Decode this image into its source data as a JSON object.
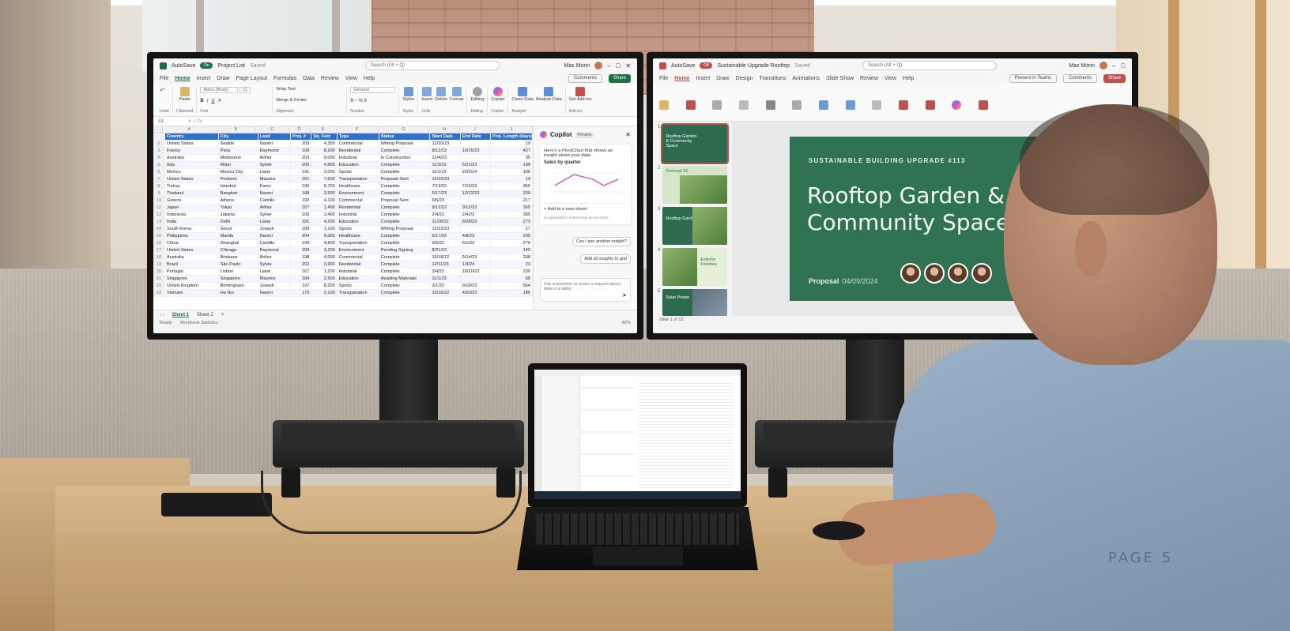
{
  "page_label": "PAGE 5",
  "excel": {
    "autosave": "AutoSave",
    "toggle": "On",
    "file_name": "Project List",
    "saved": "Saved",
    "search": "Search (Alt + Q)",
    "user": "Max Morin",
    "tabs": [
      "File",
      "Home",
      "Insert",
      "Draw",
      "Page Layout",
      "Formulas",
      "Data",
      "Review",
      "View",
      "Help"
    ],
    "comments": "Comments",
    "share": "Share",
    "ribbon": {
      "font": "Aptos (Body)",
      "size": "11",
      "wrap": "Wrap Text",
      "merge": "Merge & Center",
      "number_format": "General",
      "styles": "Styles",
      "insert": "Insert",
      "delete": "Delete",
      "format": "Format",
      "editing": "Editing",
      "copilot": "Copilot",
      "clean": "Clean Data",
      "analyze": "Analyze Data",
      "addins": "Get Add-ins",
      "undo": "Undo",
      "clipboard": "Clipboard",
      "paste": "Paste",
      "font_group": "Font",
      "alignment": "Alignment",
      "number": "Number",
      "styles_group": "Styles",
      "cells": "Cells",
      "editing_group": "Editing",
      "copilot_group": "Copilot",
      "analysis": "Analysis",
      "addins_group": "Add-ins"
    },
    "cell_ref": "A1",
    "columns": [
      "A",
      "B",
      "C",
      "D",
      "E",
      "F",
      "G",
      "H",
      "I",
      "J"
    ],
    "headers": [
      "Country",
      "City",
      "Lead",
      "Proj. #",
      "Sq. Feet",
      "Type",
      "Status",
      "Start Date",
      "End Date",
      "Proj. Length (days)"
    ],
    "rows": [
      [
        "United States",
        "Seattle",
        "Naomi",
        "205",
        "4,300",
        "Commercial",
        "Writing Proposal",
        "12/20/23",
        "",
        "19"
      ],
      [
        "France",
        "Paris",
        "Raymond",
        "108",
        "8,200",
        "Residential",
        "Complete",
        "8/12/22",
        "10/15/23",
        "427"
      ],
      [
        "Australia",
        "Melbourne",
        "Arthur",
        "203",
        "9,000",
        "Industrial",
        "In Construction",
        "12/4/23",
        "",
        "35"
      ],
      [
        "Italy",
        "Milan",
        "Sylvie",
        "206",
        "4,800",
        "Education",
        "Complete",
        "11/3/22",
        "5/21/23",
        "199"
      ],
      [
        "Mexico",
        "Mexico City",
        "Liane",
        "191",
        "3,000",
        "Sports",
        "Complete",
        "11/1/23",
        "2/25/24",
        "106"
      ],
      [
        "United States",
        "Portland",
        "Maurice",
        "201",
        "7,600",
        "Transportation",
        "Proposal Sent",
        "12/20/23",
        "",
        "19"
      ],
      [
        "Turkey",
        "Istanbul",
        "Fanni",
        "190",
        "6,700",
        "Healthcare",
        "Complete",
        "7/13/22",
        "7/15/23",
        "365"
      ],
      [
        "Thailand",
        "Bangkok",
        "Naomi",
        "188",
        "3,500",
        "Environment",
        "Complete",
        "5/17/23",
        "12/12/23",
        "209"
      ],
      [
        "Greece",
        "Athens",
        "Camille",
        "192",
        "4,100",
        "Commercial",
        "Proposal Sent",
        "6/5/23",
        "",
        "217"
      ],
      [
        "Japan",
        "Tokyo",
        "Arthur",
        "207",
        "1,400",
        "Residential",
        "Complete",
        "9/12/22",
        "9/12/23",
        "365"
      ],
      [
        "Indonesia",
        "Jakarta",
        "Sylvie",
        "109",
        "3,400",
        "Industrial",
        "Complete",
        "2/4/22",
        "2/4/23",
        "365"
      ],
      [
        "India",
        "Delhi",
        "Liane",
        "181",
        "4,200",
        "Education",
        "Complete",
        "11/28/22",
        "8/28/23",
        "273"
      ],
      [
        "South Korea",
        "Seoul",
        "Joseph",
        "189",
        "1,100",
        "Sports",
        "Writing Proposal",
        "12/22/23",
        "",
        "17"
      ],
      [
        "Philippines",
        "Manila",
        "Naomi",
        "204",
        "9,000",
        "Healthcare",
        "Complete",
        "6/17/22",
        "4/8/23",
        "295"
      ],
      [
        "China",
        "Shanghai",
        "Camille",
        "199",
        "4,800",
        "Transportation",
        "Complete",
        "9/5/22",
        "6/1/23",
        "279"
      ],
      [
        "United States",
        "Chicago",
        "Raymond",
        "209",
        "3,200",
        "Environment",
        "Pending Signing",
        "8/21/23",
        "",
        "140"
      ],
      [
        "Australia",
        "Brisbane",
        "Arthur",
        "198",
        "4,000",
        "Commercial",
        "Complete",
        "10/18/22",
        "5/14/23",
        "208"
      ],
      [
        "Brazil",
        "São Paulo",
        "Sylvie",
        "202",
        "3,900",
        "Residential",
        "Complete",
        "12/11/23",
        "1/3/24",
        "23"
      ],
      [
        "Portugal",
        "Lisbon",
        "Liane",
        "167",
        "1,200",
        "Industrial",
        "Complete",
        "3/4/22",
        "10/20/22",
        "230"
      ],
      [
        "Singapore",
        "Singapore",
        "Maurice",
        "184",
        "2,500",
        "Education",
        "Awaiting Materials",
        "11/1/23",
        "",
        "68"
      ],
      [
        "United Kingdom",
        "Birmingham",
        "Joseph",
        "197",
        "8,200",
        "Sports",
        "Complete",
        "3/1/22",
        "9/16/23",
        "564"
      ],
      [
        "Vietnam",
        "Ha Noi",
        "Naomi",
        "175",
        "2,100",
        "Transportation",
        "Complete",
        "10/16/22",
        "4/20/23",
        "186"
      ]
    ],
    "sheets": [
      "Sheet 1",
      "Sheet 2",
      "+"
    ],
    "status": [
      "Ready",
      "Workbook Statistics"
    ],
    "zoom": "80%",
    "copilot": {
      "title": "Copilot",
      "badge": "Preview",
      "message": "Here's a PivotChart that shows an insight about your data.",
      "chart_title": "Sales by quarter",
      "add_sheet": "+ Add to a new sheet",
      "disclaimer": "AI-generated content may be incorrect",
      "suggestion1": "Can I see another insight?",
      "suggestion2": "Add all insights to grid",
      "input_placeholder": "Ask a question or make a request about data in a table"
    }
  },
  "ppt": {
    "autosave": "AutoSave",
    "toggle": "Off",
    "file_name": "Sustainable Upgrade Rooftop",
    "saved": "Saved",
    "search": "Search (Alt + Q)",
    "user": "Max Morin",
    "tabs": [
      "File",
      "Home",
      "Insert",
      "Draw",
      "Design",
      "Transitions",
      "Animations",
      "Slide Show",
      "Review",
      "View",
      "Help"
    ],
    "present": "Present in Teams",
    "comments": "Comments",
    "share": "Share",
    "thumbs": [
      {
        "num": "1",
        "text": "Rooftop Garden & Community Space"
      },
      {
        "num": "2",
        "text": "Concept 01"
      },
      {
        "num": "3",
        "text": "Rooftop Garden"
      },
      {
        "num": "4",
        "text": "Exterior Finishes"
      },
      {
        "num": "5",
        "text": "Solar Power"
      }
    ],
    "slide": {
      "kicker": "SUSTAINABLE BUILDING UPGRADE #113",
      "title_line1": "Rooftop Garden &",
      "title_line2": "Community Space",
      "foot_label": "Proposal",
      "foot_date": "04/09/2024"
    },
    "status": "Slide 1 of 12"
  },
  "colors": {
    "excel_green": "#1e7145",
    "excel_header_blue": "#2f6fd1",
    "ppt_red": "#c0504d",
    "slide_green": "#2f7352",
    "copilot_line": "#d84fc2"
  }
}
